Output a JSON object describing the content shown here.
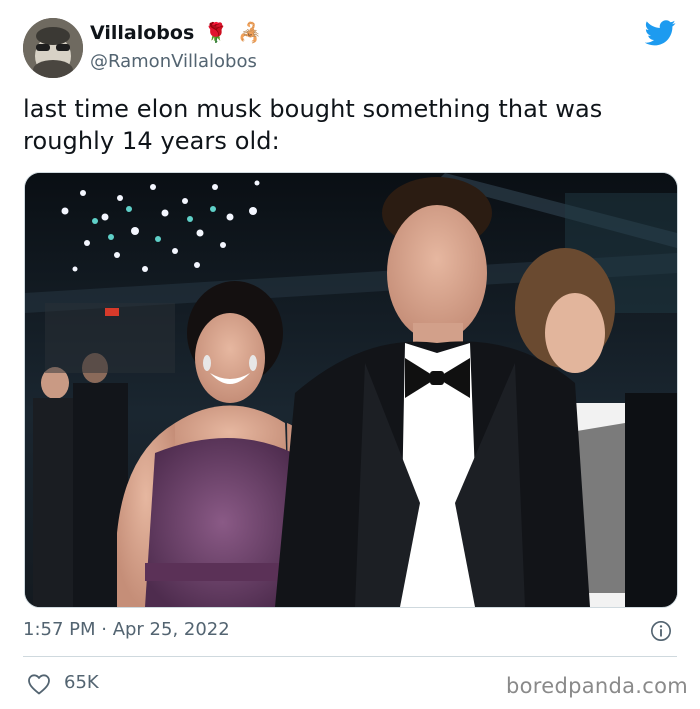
{
  "tweet": {
    "author": {
      "display_name": "Villalobos",
      "name_emojis": [
        "🌹",
        "🦂"
      ],
      "handle": "@RamonVillalobos",
      "avatar_icon": "avatar"
    },
    "brand_icon": "twitter-bird-icon",
    "brand_color": "#1d9bf0",
    "text": "last time elon musk bought something that was roughly 14 years old:",
    "timestamp": "1:57 PM · Apr 25, 2022",
    "likes": "65K",
    "like_icon": "heart-icon",
    "info_icon": "info-icon"
  },
  "watermark": "boredpanda.com"
}
